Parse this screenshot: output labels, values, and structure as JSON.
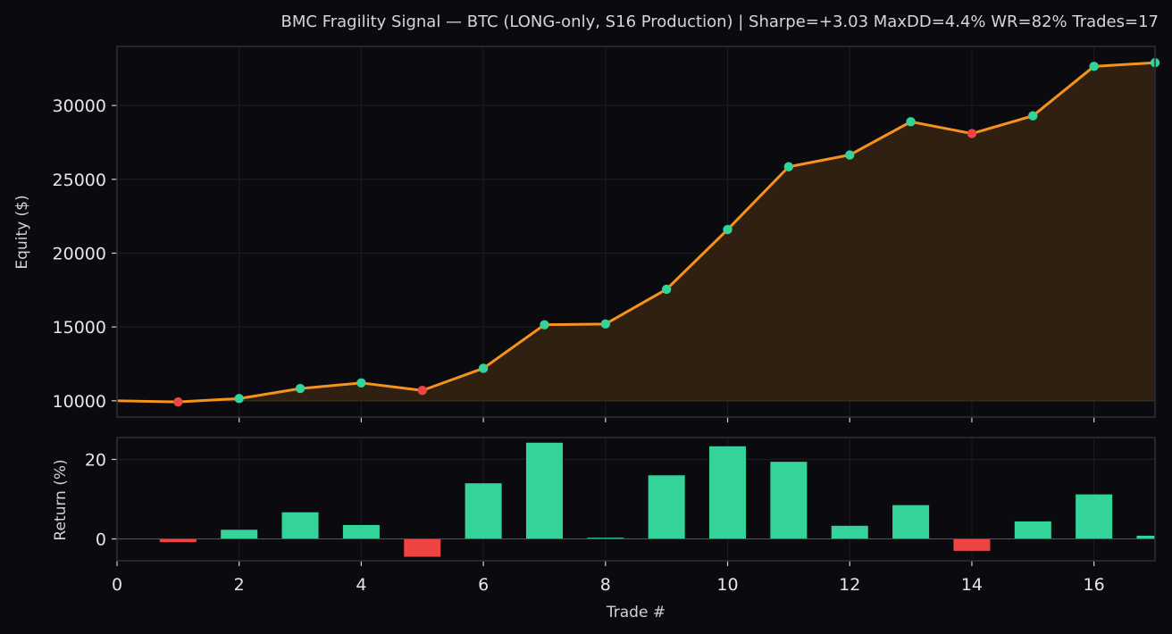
{
  "colors": {
    "background": "#0b0b0f",
    "panel": "#0b0b0f",
    "frame": "#2a2a33",
    "grid": "#1c1c22",
    "equity_line": "#f7931a",
    "equity_fill": "#2f2012",
    "win": "#34d399",
    "loss": "#ef4444",
    "text": "#e6e6e6"
  },
  "chart_data": [
    {
      "type": "line",
      "title": "BMC Fragility Signal — BTC (LONG-only, S16 Production)  |  Sharpe=+3.03  MaxDD=4.4%  WR=82%  Trades=17",
      "xlabel": "",
      "ylabel": "Equity ($)",
      "x": [
        0,
        1,
        2,
        3,
        4,
        5,
        6,
        7,
        8,
        9,
        10,
        11,
        12,
        13,
        14,
        15,
        16,
        17
      ],
      "series": [
        {
          "values": [
            10000,
            9920,
            10150,
            10830,
            11210,
            10700,
            12200,
            15150,
            15200,
            17550,
            21600,
            25850,
            26650,
            28900,
            28100,
            29300,
            32650,
            32900
          ]
        }
      ],
      "point_outcome": [
        "start",
        "loss",
        "win",
        "win",
        "win",
        "loss",
        "win",
        "win",
        "win",
        "win",
        "win",
        "win",
        "win",
        "win",
        "loss",
        "win",
        "win",
        "win"
      ],
      "baseline": 10000,
      "xlim": [
        0,
        17
      ],
      "ylim": [
        8900,
        34000
      ],
      "yticks": [
        10000,
        15000,
        20000,
        25000,
        30000
      ],
      "xticks": [
        2,
        4,
        6,
        8,
        10,
        12,
        14,
        16
      ],
      "grid": true,
      "area_fill": true
    },
    {
      "type": "bar",
      "title": "",
      "xlabel": "Trade #",
      "ylabel": "Return (%)",
      "x": [
        1,
        2,
        3,
        4,
        5,
        6,
        7,
        8,
        9,
        10,
        11,
        12,
        13,
        14,
        15,
        16,
        17
      ],
      "values": [
        -0.8,
        2.3,
        6.7,
        3.5,
        -4.5,
        14.0,
        24.2,
        0.3,
        16.0,
        23.3,
        19.4,
        3.3,
        8.5,
        -3.0,
        4.4,
        11.2,
        0.8
      ],
      "xlim": [
        0,
        17
      ],
      "ylim": [
        -5.5,
        25.5
      ],
      "yticks": [
        0,
        20
      ],
      "xticks": [
        0,
        2,
        4,
        6,
        8,
        10,
        12,
        14,
        16
      ],
      "grid": true
    }
  ]
}
